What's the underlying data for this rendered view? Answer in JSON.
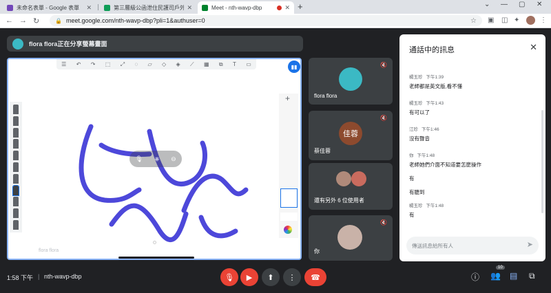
{
  "browser": {
    "tabs": [
      {
        "title": "未命名表單 - Google 表單",
        "active": false,
        "icon_color": "#7248b9"
      },
      {
        "title": "第三層級公函泄住民護司戶外新...",
        "active": false,
        "icon_color": "#0f9d58"
      },
      {
        "title": "Meet - nth-wavp-dbp",
        "active": true,
        "icon_color": "#00832d"
      }
    ],
    "new_tab": "+",
    "url": "meet.google.com/nth-wavp-dbp?pli=1&authuser=0"
  },
  "presenting_banner": "flora flora正在分享螢幕畫面",
  "shared_screen": {
    "presenter_name": "flora flora",
    "stroke_color": "#3a35d6"
  },
  "tiles": [
    {
      "name": "flora flora",
      "avatar_text": "",
      "avatar_color": "#3bb9c4",
      "muted": true
    },
    {
      "name": "蔡佳蓉",
      "avatar_text": "佳蓉",
      "avatar_color": "#8d4a2e",
      "muted": true
    },
    {
      "name": "還有另外 6 位使用者",
      "avatar_text": "",
      "muted": false
    },
    {
      "name": "你",
      "avatar_text": "",
      "muted": true
    }
  ],
  "chat": {
    "title": "通話中的訊息",
    "input_placeholder": "傳送訊息給所有人",
    "messages": [
      {
        "sender": "楊玉珍",
        "time": "下午1:39",
        "lines": [
          "老師都是英文版,看不懂"
        ]
      },
      {
        "sender": "楊玉珍",
        "time": "下午1:43",
        "lines": [
          "有可以了"
        ]
      },
      {
        "sender": "江珍",
        "time": "下午1:46",
        "lines": [
          "沒有聲音"
        ]
      },
      {
        "sender": "你",
        "time": "下午1:48",
        "lines": [
          "老師她們介面不知道要怎麼操作",
          "有",
          "有聽到"
        ]
      },
      {
        "sender": "楊玉珍",
        "time": "下午1:48",
        "lines": [
          "有"
        ]
      }
    ]
  },
  "bottom": {
    "time": "1:58 下午",
    "meeting_code": "nth-wavp-dbp",
    "participants_count": "10"
  }
}
